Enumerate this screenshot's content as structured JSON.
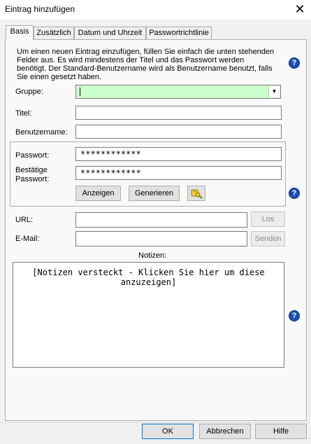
{
  "window": {
    "title": "Eintrag hinzufügen",
    "close_glyph": "✕"
  },
  "tabs": [
    {
      "label": "Basis",
      "active": true
    },
    {
      "label": "Zusätzlich",
      "active": false
    },
    {
      "label": "Datum und Uhrzeit",
      "active": false
    },
    {
      "label": "Passwortrichtlinie",
      "active": false
    }
  ],
  "description": "Um einen neuen Eintrag einzufügen, füllen Sie einfach die unten stehenden Felder aus. Es wird mindestens der Titel und das Passwort werden benötigt. Der Standard-Benutzername wird als Benutzername benutzt, falls Sie einen gesetzt haben.",
  "help_glyph": "?",
  "fields": {
    "group_label": "Gruppe:",
    "group_value": "",
    "title_label": "Titel:",
    "title_value": "",
    "username_label": "Benutzername:",
    "username_value": "",
    "password_label": "Passwort:",
    "password_value": "************",
    "confirm_label_1": "Bestätige",
    "confirm_label_2": "Passwort:",
    "confirm_value": "************",
    "url_label": "URL:",
    "url_value": "",
    "email_label": "E-Mail:",
    "email_value": "",
    "notes_label": "Notizen:"
  },
  "buttons": {
    "show": "Anzeigen",
    "generate": "Generieren",
    "go": "Los",
    "send": "Senden",
    "ok": "OK",
    "cancel": "Abbrechen",
    "help": "Hilfe"
  },
  "notes_placeholder": "[Notizen versteckt - Klicken Sie hier um diese anzuzeigen]",
  "colors": {
    "group_bg": "#ccffcc",
    "help_icon": "#1a4fb0",
    "key_icon": "#e8c02a"
  },
  "icons": {
    "combo": "chevron-down-icon",
    "generator": "key-generator-icon",
    "help": "help-icon"
  }
}
